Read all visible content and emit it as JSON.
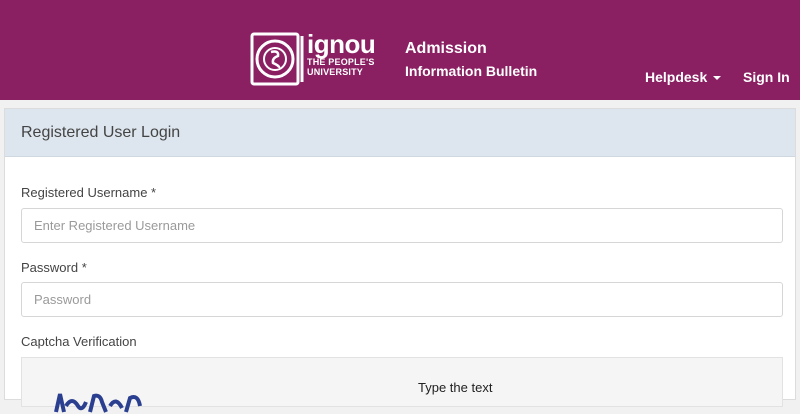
{
  "header": {
    "logo_word": "ignou",
    "logo_sub1": "THE PEOPLE'S",
    "logo_sub2": "UNIVERSITY",
    "title": "Admission",
    "subtitle": "Information Bulletin",
    "nav": {
      "helpdesk": "Helpdesk",
      "signin": "Sign In"
    },
    "bg_color": "#8a1f62"
  },
  "login": {
    "panel_title": "Registered User Login",
    "username_label": "Registered Username *",
    "username_placeholder": "Enter Registered Username",
    "password_label": "Password *",
    "password_placeholder": "Password",
    "captcha_label": "Captcha Verification",
    "captcha_hint": "Type the text"
  }
}
